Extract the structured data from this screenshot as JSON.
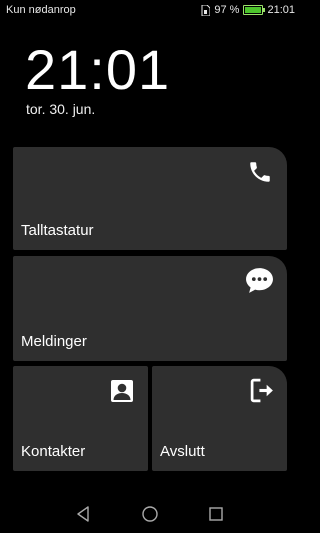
{
  "status": {
    "carrier": "Kun nødanrop",
    "battery_percent": "97 %",
    "battery_level": 0.97,
    "time": "21:01"
  },
  "lock": {
    "time": "21:01",
    "date": "tor. 30. jun."
  },
  "tiles": {
    "dialpad": {
      "label": "Talltastatur",
      "icon": "phone-icon"
    },
    "messages": {
      "label": "Meldinger",
      "icon": "chat-bubble-icon"
    },
    "contacts": {
      "label": "Kontakter",
      "icon": "person-icon"
    },
    "exit": {
      "label": "Avslutt",
      "icon": "exit-icon"
    }
  },
  "navbar": {
    "back": "back-icon",
    "home": "home-icon",
    "recents": "recents-icon"
  },
  "colors": {
    "tile_bg": "#2f2f2f",
    "battery": "#4cc52b"
  }
}
